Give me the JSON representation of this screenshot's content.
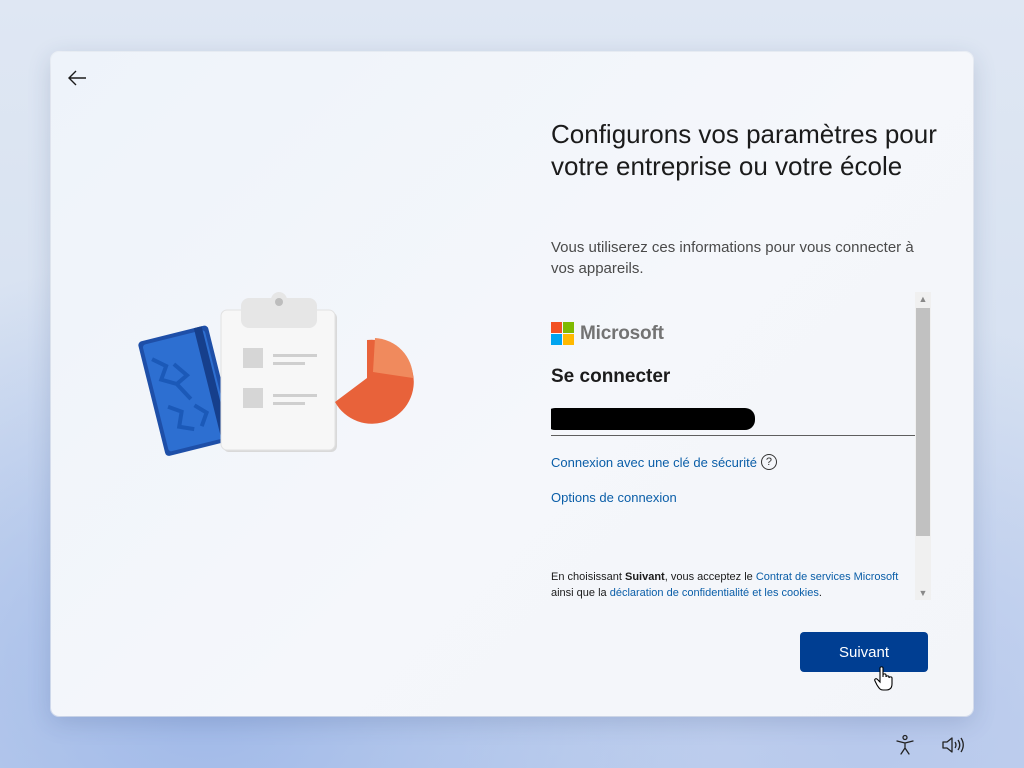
{
  "setup": {
    "title": "Configurons vos paramètres pour votre entreprise ou votre école",
    "subtitle": "Vous utiliserez ces informations pour vous connecter à vos appareils.",
    "back_icon": "back-arrow-icon",
    "next_label": "Suivant"
  },
  "signin": {
    "brand": "Microsoft",
    "heading": "Se connecter",
    "email_value": "",
    "security_key_link": "Connexion avec une clé de sécurité",
    "help_glyph": "?",
    "options_link": "Options de connexion",
    "consent": {
      "prefix": "En choisissant ",
      "bold": "Suivant",
      "middle": ", vous acceptez le ",
      "terms_link": "Contrat de services Microsoft",
      "line2_prefix": "ainsi que la ",
      "privacy_link": "déclaration de confidentialité et les cookies",
      "line2_suffix": "."
    }
  },
  "tray": {
    "accessibility_icon": "accessibility-icon",
    "volume_icon": "volume-icon"
  },
  "colors": {
    "accent": "#003e92",
    "link": "#0a5ea8",
    "ms_red": "#f25022",
    "ms_green": "#7fba00",
    "ms_blue": "#00a4ef",
    "ms_yellow": "#ffb900"
  }
}
